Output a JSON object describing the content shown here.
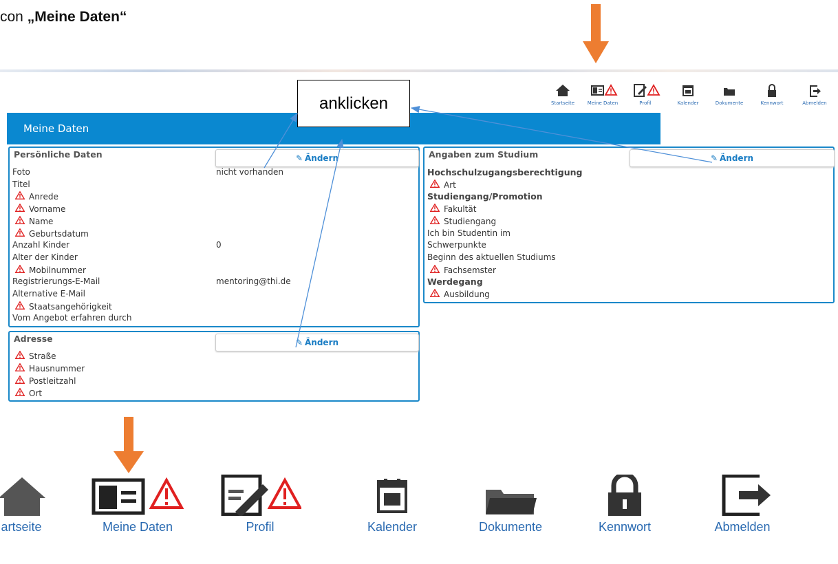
{
  "caption": {
    "prefix": "con ",
    "bold": "„Meine Daten“"
  },
  "callout": "anklicken",
  "nav": [
    {
      "label": "Startseite",
      "icon": "home-icon"
    },
    {
      "label": "Meine Daten",
      "icon": "id-card-icon"
    },
    {
      "label": "Profil",
      "icon": "edit-document-icon"
    },
    {
      "label": "Kalender",
      "icon": "calendar-icon"
    },
    {
      "label": "Dokumente",
      "icon": "folder-icon"
    },
    {
      "label": "Kennwort",
      "icon": "lock-icon"
    },
    {
      "label": "Abmelden",
      "icon": "logout-icon"
    }
  ],
  "big_nav": [
    "artseite",
    "Meine Daten",
    "Profil",
    "Kalender",
    "Dokumente",
    "Kennwort",
    "Abmelden"
  ],
  "header_title": "Meine Daten",
  "edit_label": "Ändern",
  "personal": {
    "title": "Persönliche Daten",
    "rows": [
      {
        "label": "Foto",
        "value": "nicht vorhanden",
        "warn": false
      },
      {
        "label": "Titel",
        "value": "",
        "warn": false
      },
      {
        "label": "Anrede",
        "value": "",
        "warn": true
      },
      {
        "label": "Vorname",
        "value": "",
        "warn": true
      },
      {
        "label": "Name",
        "value": "",
        "warn": true
      },
      {
        "label": "Geburtsdatum",
        "value": "",
        "warn": true
      },
      {
        "label": "Anzahl Kinder",
        "value": "0",
        "warn": false
      },
      {
        "label": "Alter der Kinder",
        "value": "",
        "warn": false
      },
      {
        "label": "Mobilnummer",
        "value": "",
        "warn": true
      },
      {
        "label": "Registrierungs-E-Mail",
        "value": "mentoring@thi.de",
        "warn": false
      },
      {
        "label": "Alternative E-Mail",
        "value": "",
        "warn": false
      },
      {
        "label": "Staatsangehörigkeit",
        "value": "",
        "warn": true
      },
      {
        "label": "Vom Angebot erfahren durch",
        "value": "",
        "warn": false
      }
    ]
  },
  "address": {
    "title": "Adresse",
    "rows": [
      "Straße",
      "Hausnummer",
      "Postleitzahl",
      "Ort"
    ]
  },
  "study": {
    "title": "Angaben zum Studium",
    "lines": [
      {
        "text": "Hochschulzugangsberechtigung",
        "type": "section"
      },
      {
        "text": "Art",
        "type": "warn"
      },
      {
        "text": "Studiengang/Promotion",
        "type": "section"
      },
      {
        "text": "Fakultät",
        "type": "warn"
      },
      {
        "text": "Studiengang",
        "type": "warn"
      },
      {
        "text": "Ich bin Studentin im",
        "type": "plain"
      },
      {
        "text": "Schwerpunkte",
        "type": "plain"
      },
      {
        "text": "Beginn des aktuellen Studiums",
        "type": "plain"
      },
      {
        "text": "Fachsemster",
        "type": "warn"
      },
      {
        "text": "Werdegang",
        "type": "section"
      },
      {
        "text": "Ausbildung",
        "type": "warn"
      }
    ]
  },
  "colors": {
    "accent": "#0a88d0",
    "border": "#1a88c9",
    "warning": "#e02020",
    "arrow": "#ed7d31",
    "pointer": "#4f90d8"
  }
}
